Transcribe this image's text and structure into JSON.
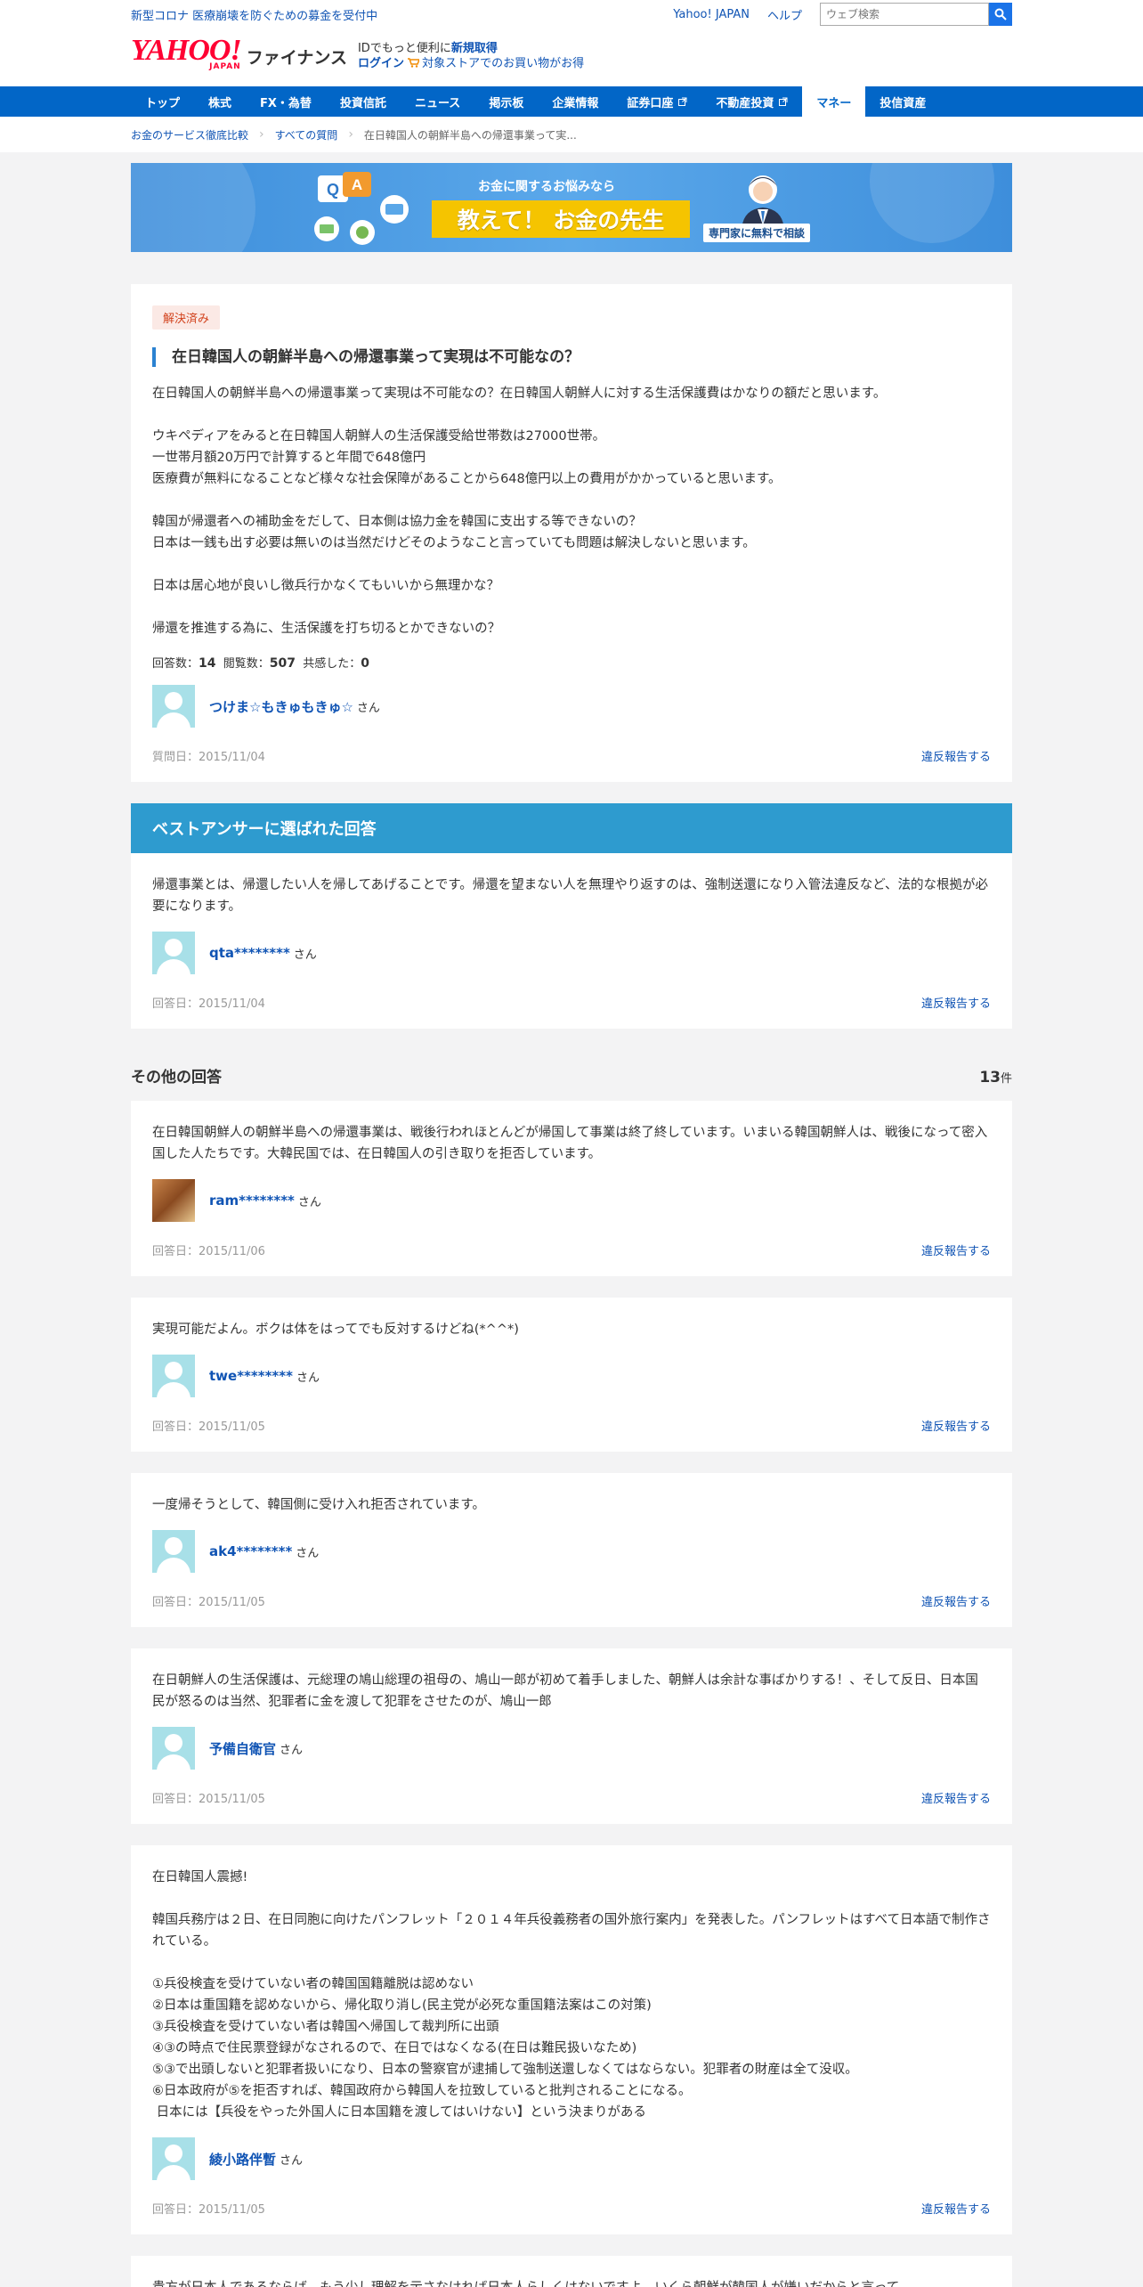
{
  "topbar": {
    "notice": "新型コロナ 医療崩壊を防ぐための募金を受付中",
    "yahoo_japan": "Yahoo! JAPAN",
    "help": "ヘルプ",
    "search_placeholder": "ウェブ検索"
  },
  "header": {
    "logo_main": "YAHOO!",
    "logo_sub": "JAPAN",
    "logo_finance": "ファイナンス",
    "promo_prefix": "IDでもっと便利に",
    "register": "新規取得",
    "login": "ログイン",
    "store": "対象ストアでのお買い物がお得"
  },
  "nav": [
    {
      "label": "トップ"
    },
    {
      "label": "株式"
    },
    {
      "label": "FX・為替"
    },
    {
      "label": "投資信託"
    },
    {
      "label": "ニュース"
    },
    {
      "label": "掲示板"
    },
    {
      "label": "企業情報"
    },
    {
      "label": "証券口座",
      "external": true
    },
    {
      "label": "不動産投資",
      "external": true
    },
    {
      "label": "マネー",
      "active": true
    },
    {
      "label": "投信資産"
    }
  ],
  "breadcrumb": {
    "item1": "お金のサービス徹底比較",
    "item2": "すべての質問",
    "current": "在日韓国人の朝鮮半島への帰還事業って実..."
  },
  "banner": {
    "tagline": "お金に関するお悩みなら",
    "title": "教えて！ お金の先生",
    "pill": "専門家に無料で相談",
    "qa_q": "Q",
    "qa_a": "A"
  },
  "question": {
    "status": "解決済み",
    "title": "在日韓国人の朝鮮半島への帰還事業って実現は不可能なの？",
    "body": "在日韓国人の朝鮮半島への帰還事業って実現は不可能なの？在日韓国人朝鮮人に対する生活保護費はかなりの額だと思います。\n\nウキペディアをみると在日韓国人朝鮮人の生活保護受給世帯数は27000世帯。\n一世帯月額20万円で計算すると年間で648億円\n医療費が無料になることなど様々な社会保障があることから648億円以上の費用がかかっていると思います。\n\n韓国が帰還者への補助金をだして、日本側は協力金を韓国に支出する等できないの？\n日本は一銭も出す必要は無いのは当然だけどそのようなこと言っていても問題は解決しないと思います。\n\n日本は居心地が良いし徴兵行かなくてもいいから無理かな？\n\n帰還を推進する為に、生活保護を打ち切るとかできないの？",
    "answers_label": "回答数：",
    "answers": "14",
    "views_label": "閲覧数：",
    "views": "507",
    "empathy_label": "共感した：",
    "empathy": "0",
    "user": "つけま☆もきゅもきゅ☆",
    "san": "さん",
    "date": "質問日：2015/11/04",
    "report": "違反報告する"
  },
  "best_answer": {
    "heading": "ベストアンサーに選ばれた回答",
    "body": "帰還事業とは、帰還したい人を帰してあげることです。帰還を望まない人を無理やり返すのは、強制送還になり入管法違反など、法的な根拠が必要になります。",
    "user": "qta********",
    "san": "さん",
    "date": "回答日：2015/11/04",
    "report": "違反報告する"
  },
  "others": {
    "heading": "その他の回答",
    "count": "13",
    "count_unit": "件",
    "answers": [
      {
        "body": "在日韓国朝鮮人の朝鮮半島への帰還事業は、戦後行われほとんどが帰国して事業は終了終しています。いまいる韓国朝鮮人は、戦後になって密入国した人たちです。大韓民国では、在日韓国人の引き取りを拒否しています。",
        "user": "ram********",
        "san": "さん",
        "photo": true,
        "date": "回答日：2015/11/06",
        "report": "違反報告する"
      },
      {
        "body": "実現可能だよん。ボクは体をはってでも反対するけどね(*^^*)",
        "user": "twe********",
        "san": "さん",
        "date": "回答日：2015/11/05",
        "report": "違反報告する"
      },
      {
        "body": "一度帰そうとして、韓国側に受け入れ拒否されています。",
        "user": "ak4********",
        "san": "さん",
        "date": "回答日：2015/11/05",
        "report": "違反報告する"
      },
      {
        "body": "在日朝鮮人の生活保護は、元総理の鳩山総理の祖母の、鳩山一郎が初めて着手しました、朝鮮人は余計な事ばかりする！、そして反日、日本国民が怒るのは当然、犯罪者に金を渡して犯罪をさせたのが、鳩山一郎",
        "user": "予備自衛官",
        "san": "さん",
        "date": "回答日：2015/11/05",
        "report": "違反報告する"
      },
      {
        "body": "在日韓国人震撼!\n\n韓国兵務庁は２日、在日同胞に向けたパンフレット「２０１４年兵役義務者の国外旅行案内」を発表した。パンフレットはすべて日本語で制作されている。\n\n①兵役検査を受けていない者の韓国国籍離脱は認めない\n②日本は重国籍を認めないから、帰化取り消し(民主党が必死な重国籍法案はこの対策)\n③兵役検査を受けていない者は韓国へ帰国して裁判所に出頭\n④③の時点で住民票登録がなされるので、在日ではなくなる(在日は難民扱いなため)\n⑤③で出頭しないと犯罪者扱いになり、日本の警察官が逮捕して強制送還しなくてはならない。犯罪者の財産は全て没収。\n⑥日本政府が⑤を拒否すれば、韓国政府から韓国人を拉致していると批判されることになる。\n 日本には【兵役をやった外国人に日本国籍を渡してはいけない】という決まりがある",
        "user": "綾小路伴暫",
        "san": "さん",
        "date": "回答日：2015/11/05",
        "report": "違反報告する"
      },
      {
        "body": "貴方が日本人であるならば、もう少し理解を示さなければ日本人らしくはないですよ。いくら朝鮮が韓国人が嫌いだからと言って",
        "user": "",
        "san": "",
        "date": "",
        "report": ""
      }
    ]
  }
}
